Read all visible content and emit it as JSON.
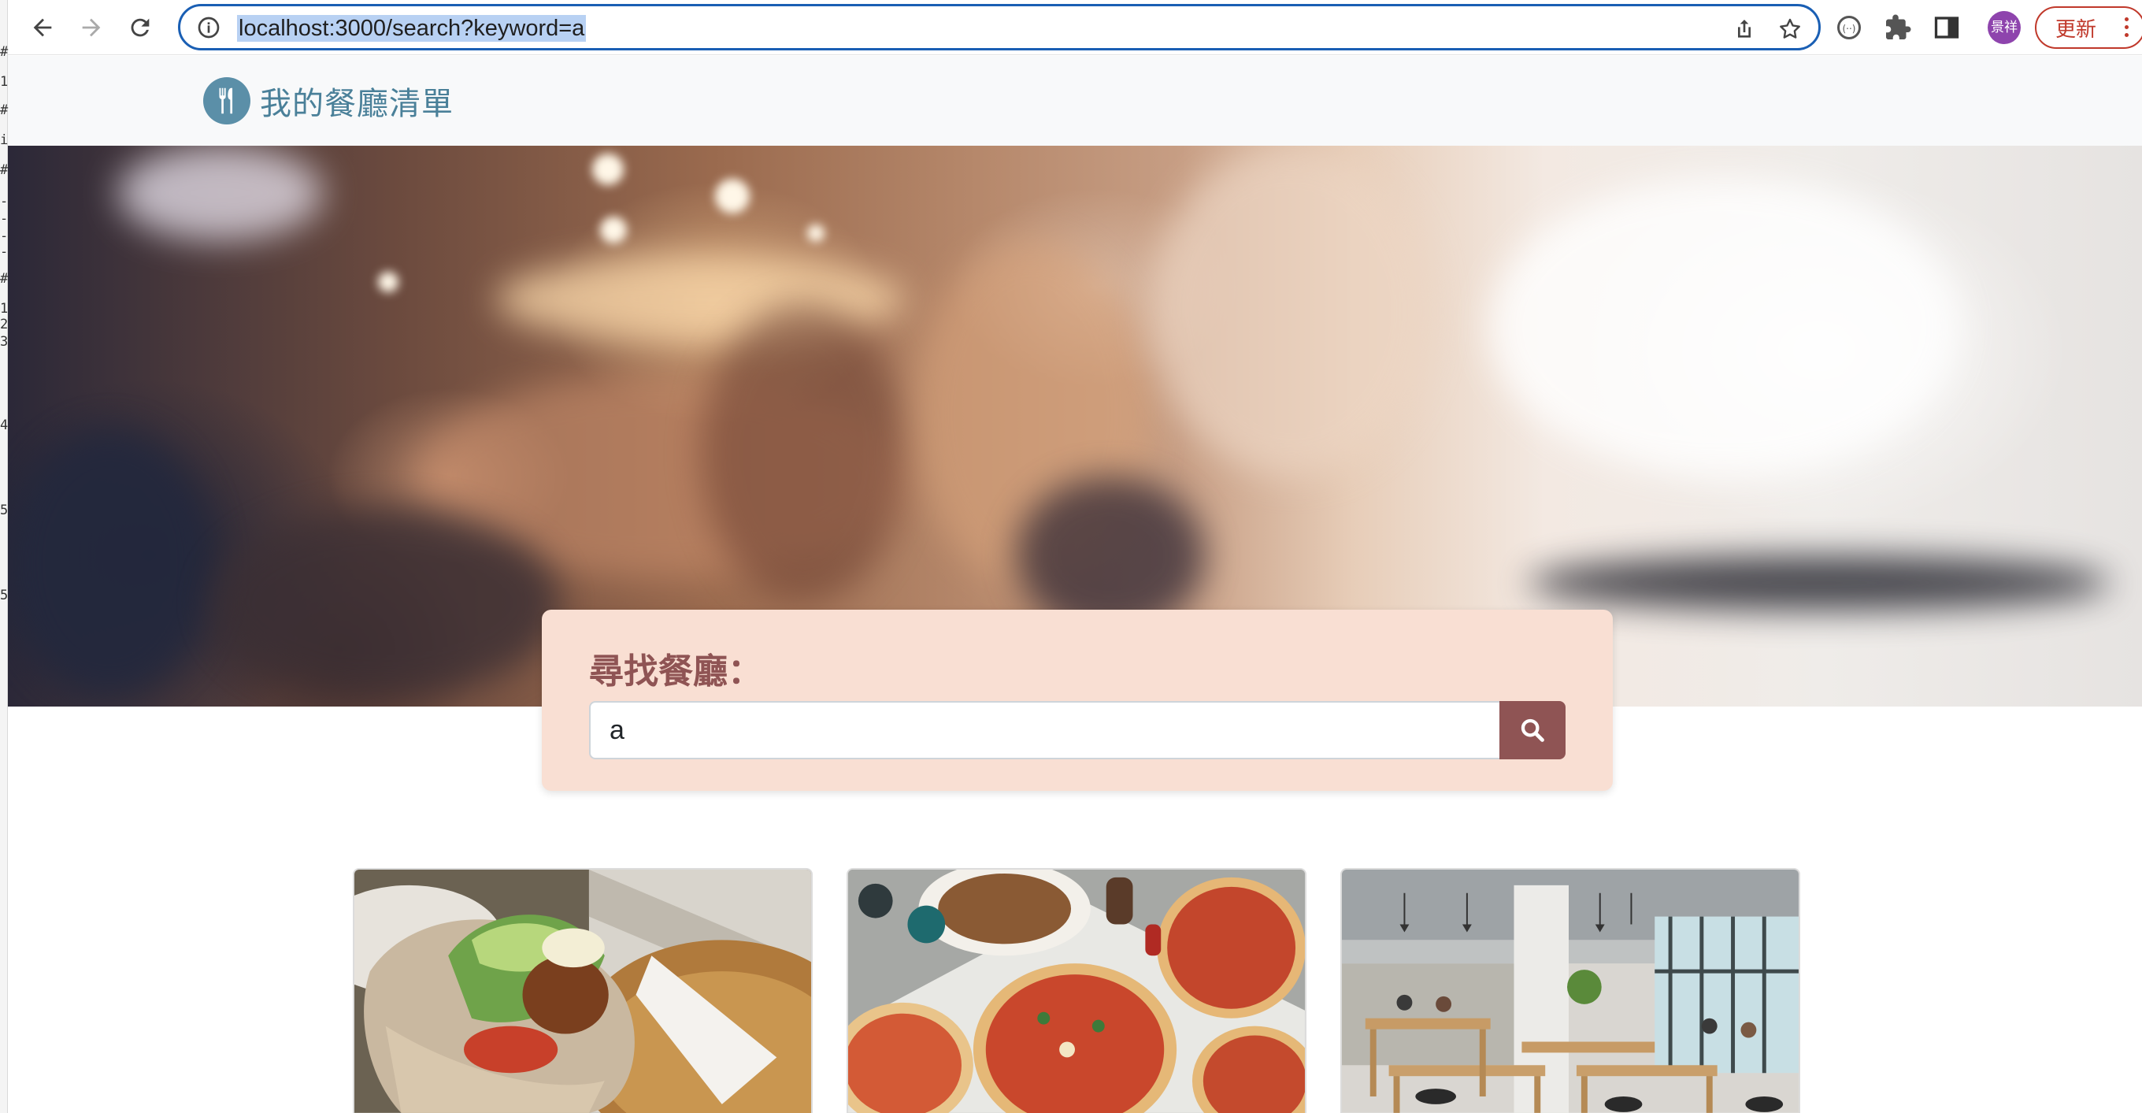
{
  "browser": {
    "url": "localhost:3000/search?keyword=a",
    "avatar_text": "景祥",
    "update_label": "更新",
    "accent_color": "#1a5fb4"
  },
  "site": {
    "brand_title": "我的餐廳清單",
    "brand_icon": "utensils-icon",
    "brand_color": "#4a8099"
  },
  "search": {
    "title": "尋找餐廳：",
    "value": "a",
    "button_icon": "search-icon",
    "card_color": "#f9dfd3",
    "accent_color": "#8f5454"
  },
  "restaurants": [
    {
      "image": "pita-sandwich-photo"
    },
    {
      "image": "pizza-table-photo"
    },
    {
      "image": "cafe-interior-photo"
    }
  ]
}
